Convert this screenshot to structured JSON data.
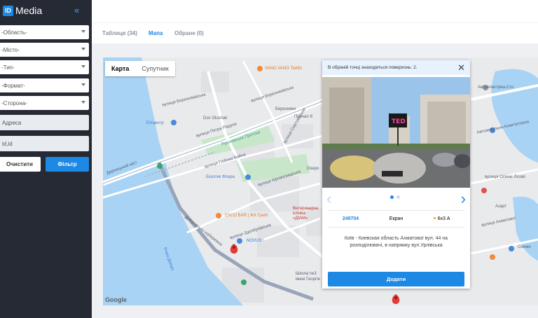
{
  "brand": {
    "logo_mark": "ID",
    "logo_text": "Media",
    "collapse_glyph": "«"
  },
  "filters": {
    "selects": [
      "-Область-",
      "-Місто-",
      "-Тип-",
      "-Формат-",
      "-Сторона-"
    ],
    "address_placeholder": "Адреса",
    "id_placeholder": "id,id",
    "clear_label": "Очистити",
    "filter_label": "Фільтр"
  },
  "tabs": [
    {
      "label": "Таблиця (34)",
      "active": false
    },
    {
      "label": "Мапа",
      "active": true
    },
    {
      "label": "Обране (0)",
      "active": false
    }
  ],
  "map": {
    "type_map": "Карта",
    "type_sat": "Супутник",
    "attribution": "Google",
    "labels": {
      "vano": "VANO VANO Тейбл",
      "berez1": "вулиця Березняківська",
      "berez2": "вулиця Березняківська",
      "doc": "Doc Glushak",
      "berezniaky": "Березняки",
      "prychal": "Причал 8",
      "rаdunka": "вулиця Петра Радуна",
      "epicentr": "Епіцентр",
      "tsvitna": "Русанівська Протока",
      "sortuvalna": "вулиця Сортувальна",
      "darnytskyi": "Дарницький міст",
      "glibova": "вулиця Глібова Вайна",
      "ekzotyk": "Екзотик Флора",
      "ozero": "Озеро",
      "klyzna": "вулиця Кіровоградська",
      "esco": "ESCO BAR | ЖК Грейт",
      "veteryn": "Ветеринарна клініка «ДІАМ»",
      "zdolbun": "вулиця Здолбунівська",
      "novus": "NOVUS",
      "dnipro": "Річка Дніпро",
      "naberezhne": "Дніпровсько набережна",
      "shkola": "Школа №3 імені Георгія",
      "avto": "Автоелектріка.Сто",
      "avtosalon": "Автомобільна Комп'ютерна",
      "osino": "вулиця Осіннє Лісові",
      "sineno": "Сінево",
      "right1": "Азарт",
      "right2": "вулиця Ахматової"
    }
  },
  "popup": {
    "header": "В обраній точці знаходиться поверхонь: 2.",
    "close": "✕",
    "prev": "‹",
    "next": "›",
    "id": "249704",
    "type": "Екран",
    "size": "6х3 А",
    "address": "Київ - Киевская область Ахматової вул. 44 на розподілювачі, в напрямку вул.Урлівська",
    "add_label": "Додати",
    "billboard_text": "TED"
  }
}
